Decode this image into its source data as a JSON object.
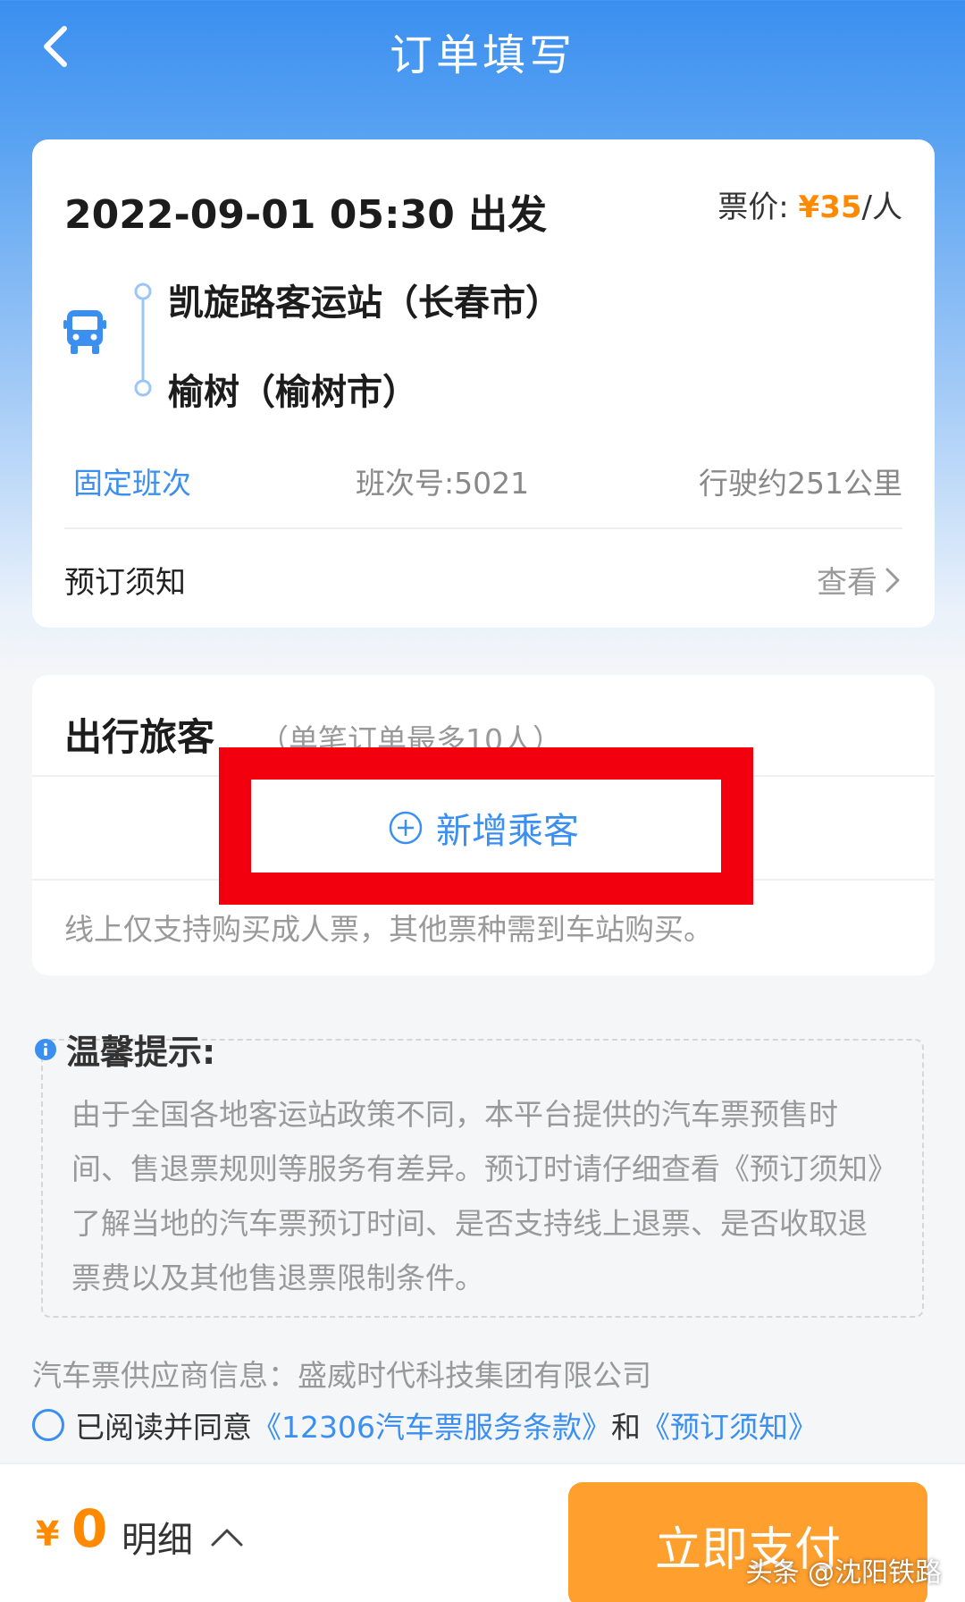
{
  "nav": {
    "title": "订单填写",
    "back_icon": "chevron-left-icon"
  },
  "trip": {
    "datetime": "2022-09-01 05:30 出发",
    "price_label": "票价:",
    "price_amount": "¥35",
    "price_unit": "/人",
    "from_station": "凯旋路客运站（长春市）",
    "to_station": "榆树（榆树市）",
    "schedule_type": "固定班次",
    "schedule_no": "班次号:5021",
    "distance": "行驶约251公里",
    "notice_label": "预订须知",
    "notice_view": "查看"
  },
  "passengers": {
    "title": "出行旅客",
    "subtitle": "（单笔订单最多10人）",
    "add_label": "新增乘客",
    "note": "线上仅支持购买成人票，其他票种需到车站购买。"
  },
  "tips": {
    "title": "温馨提示:",
    "body": "由于全国各地客运站政策不同，本平台提供的汽车票预售时间、售退票规则等服务有差异。预订时请仔细查看《预订须知》了解当地的汽车票预订时间、是否支持线上退票、是否收取退票费以及其他售退票限制条件。"
  },
  "supplier": "汽车票供应商信息：盛威时代科技集团有限公司",
  "agreement": {
    "prefix": "已阅读并同意",
    "terms_link": "《12306汽车票服务条款》",
    "and": "和",
    "notice_link": "《预订须知》"
  },
  "footer": {
    "currency": "¥",
    "total": "0",
    "detail_label": "明细",
    "pay_label": "立即支付"
  },
  "watermark": "头条 @沈阳铁路",
  "colors": {
    "primary": "#3a8ff0",
    "accent": "#ff8a00",
    "highlight": "#f3000f",
    "pay_button": "#ff9f2e"
  }
}
